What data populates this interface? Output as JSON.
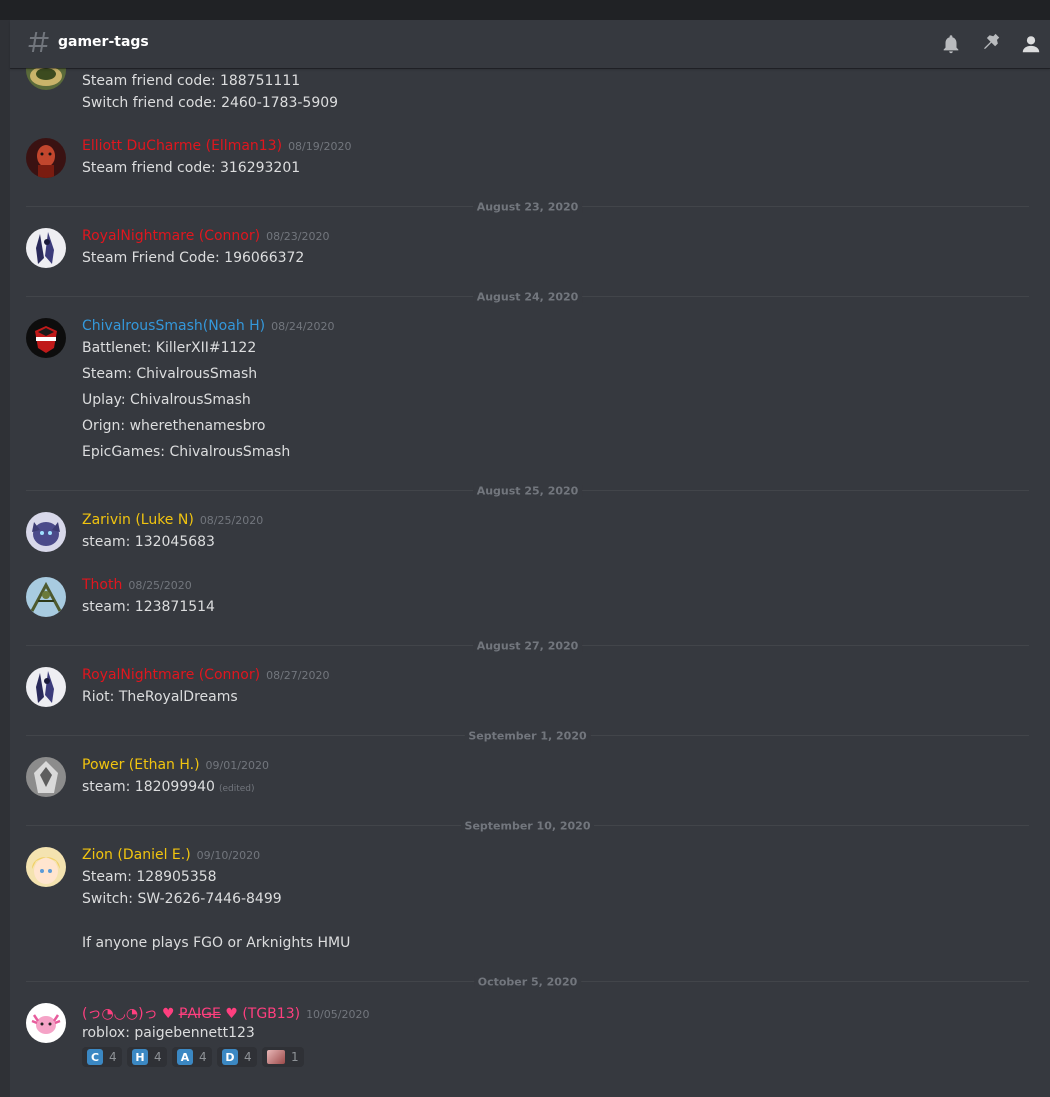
{
  "channel": {
    "name": "gamer-tags"
  },
  "header_icons": [
    "bell-icon",
    "pin-icon",
    "member-list-icon"
  ],
  "colors": {
    "red": "#e0161e",
    "blue": "#3498db",
    "gold": "#f1c40f",
    "pink": "#ff3f7f"
  },
  "messages": [
    {
      "lines": [
        "Steam friend code: 188751111",
        "Switch friend code: 2460-1783-5909"
      ]
    },
    {
      "author": "Elliott DuCharme (Ellman13)",
      "timestamp": "08/19/2020",
      "lines": [
        "Steam friend code: 316293201"
      ]
    },
    {
      "divider": "August 23, 2020"
    },
    {
      "author": "RoyalNightmare (Connor)",
      "timestamp": "08/23/2020",
      "lines": [
        "Steam Friend Code: 196066372"
      ]
    },
    {
      "divider": "August 24, 2020"
    },
    {
      "author": "ChivalrousSmash(Noah H)",
      "timestamp": "08/24/2020",
      "lines": [
        "Battlenet: KillerXII#1122",
        "Steam: ChivalrousSmash",
        "Uplay: ChivalrousSmash",
        "Orign: wherethenamesbro",
        "EpicGames: ChivalrousSmash"
      ]
    },
    {
      "divider": "August 25, 2020"
    },
    {
      "author": "Zarivin (Luke N)",
      "timestamp": "08/25/2020",
      "lines": [
        "steam: 132045683"
      ]
    },
    {
      "author": "Thoth",
      "timestamp": "08/25/2020",
      "lines": [
        "steam: 123871514"
      ]
    },
    {
      "divider": "August 27, 2020"
    },
    {
      "author": "RoyalNightmare (Connor)",
      "timestamp": "08/27/2020",
      "lines": [
        "Riot: TheRoyalDreams"
      ]
    },
    {
      "divider": "September 1, 2020"
    },
    {
      "author": "Power (Ethan H.)",
      "timestamp": "09/01/2020",
      "lines": [
        "steam: 182099940"
      ],
      "edited": "(edited)"
    },
    {
      "divider": "September 10, 2020"
    },
    {
      "author": "Zion (Daniel E.)",
      "timestamp": "09/10/2020",
      "lines": [
        "Steam: 128905358",
        "Switch: SW-2626-7446-8499",
        "If anyone plays FGO or Arknights HMU"
      ]
    },
    {
      "divider": "October 5, 2020"
    },
    {
      "author": "(っ◔◡◔)っ ♥ P̶A̶I̶G̶E̶ ♥ (TGB13)",
      "timestamp": "10/05/2020",
      "lines": [
        "roblox: paigebennett123"
      ]
    }
  ],
  "reactions": [
    {
      "emoji": "C",
      "count": "4"
    },
    {
      "emoji": "H",
      "count": "4"
    },
    {
      "emoji": "A",
      "count": "4"
    },
    {
      "emoji": "D",
      "count": "4"
    },
    {
      "emoji": "custom-emoji",
      "count": "1"
    }
  ]
}
